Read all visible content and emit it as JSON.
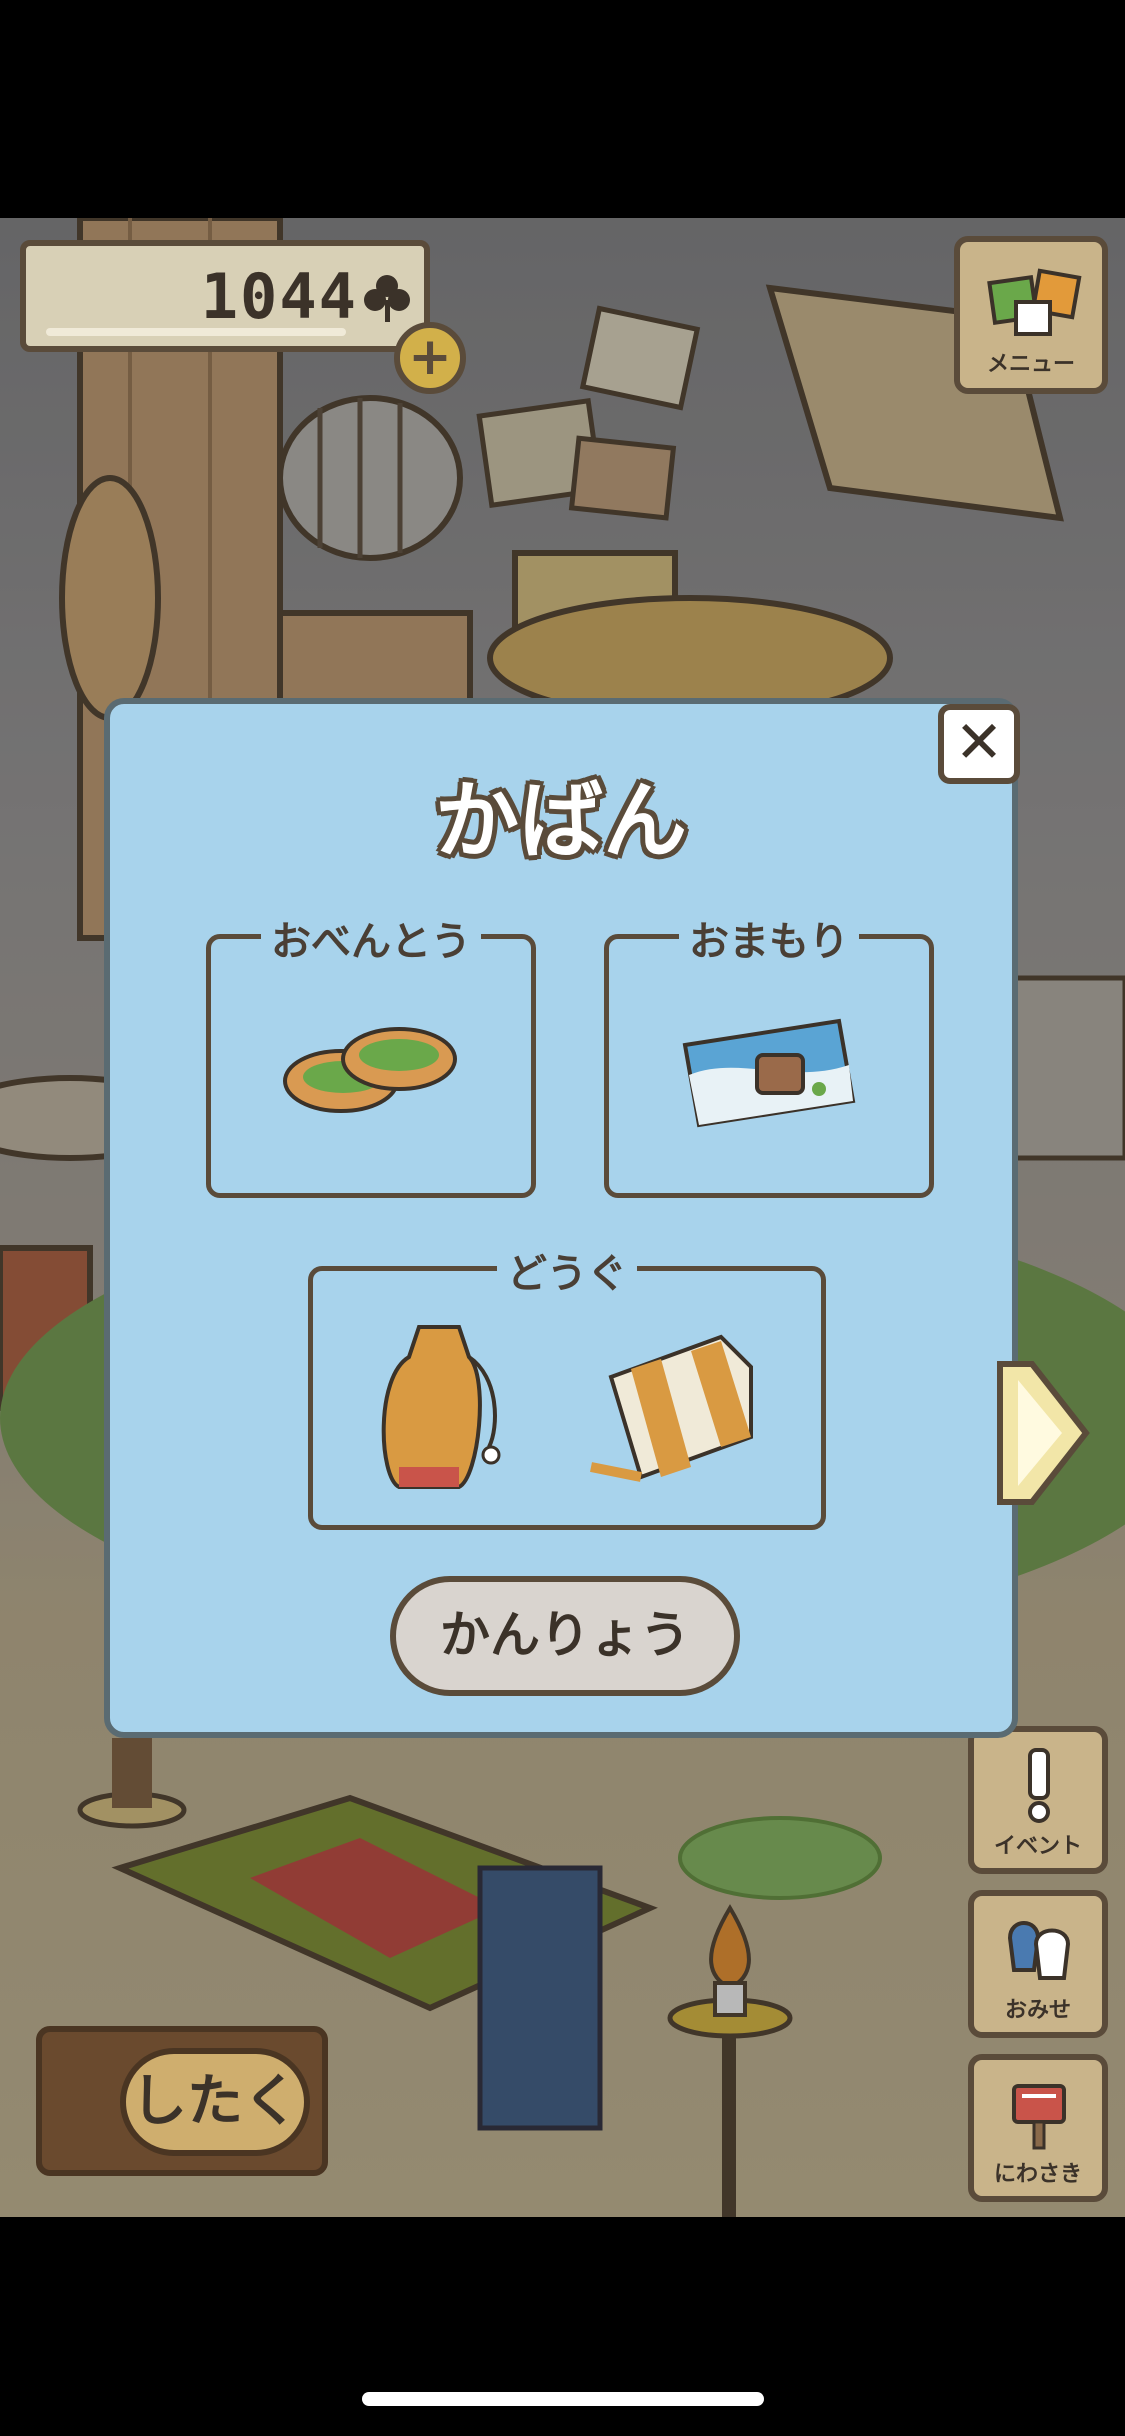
{
  "hud": {
    "clover_count": "1044",
    "plus_symbol": "+",
    "menu_label": "メニュー",
    "prepare_label": "したく"
  },
  "side_buttons": [
    {
      "label": "イベント",
      "icon": "exclamation-icon"
    },
    {
      "label": "おみせ",
      "icon": "shop-bags-icon"
    },
    {
      "label": "にわさき",
      "icon": "mailbox-icon"
    }
  ],
  "dialog": {
    "title": "かばん",
    "close_symbol": "✕",
    "slots": {
      "lunch": {
        "label": "おべんとう",
        "item": "bread-sandwich-icon"
      },
      "charm": {
        "label": "おまもり",
        "item": "postcard-bag-icon"
      },
      "tools": {
        "label": "どうぐ",
        "items": [
          "drawstring-bottle-icon",
          "striped-scarf-icon"
        ]
      }
    },
    "done_label": "かんりょう"
  },
  "colors": {
    "panel": "#a8d3ec",
    "outline": "#5a4b3a",
    "button_tan": "#c9b48a",
    "next_arrow": "#f2e6a8"
  }
}
